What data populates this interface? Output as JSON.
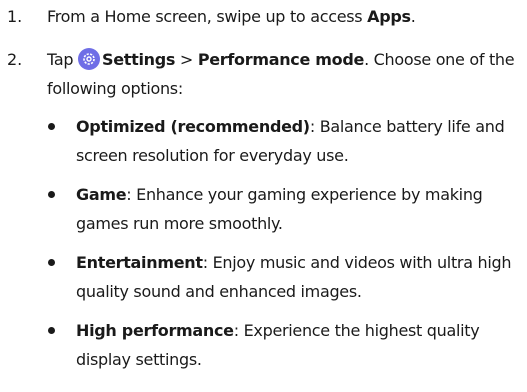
{
  "steps": [
    {
      "number": "1.",
      "text_before": "From a Home screen, swipe up to access ",
      "bold": "Apps",
      "text_after": "."
    },
    {
      "number": "2.",
      "tap": "Tap",
      "icon": "settings-gear-icon",
      "settings_label": "Settings",
      "separator": ">",
      "performance_label": "Performance mode",
      "text_after": ". Choose one of the following options:"
    }
  ],
  "options": [
    {
      "name": "Optimized (recommended)",
      "description": ": Balance battery life and screen resolution for everyday use."
    },
    {
      "name": "Game",
      "description": ": Enhance your gaming experience by making games run more smoothly."
    },
    {
      "name": "Entertainment",
      "description": ": Enjoy music and videos with ultra high quality sound and enhanced images."
    },
    {
      "name": "High performance",
      "description": ": Experience the highest quality display settings."
    }
  ],
  "colors": {
    "text": "#1a1a1a",
    "settings_icon_bg": "#6f6ee6"
  }
}
